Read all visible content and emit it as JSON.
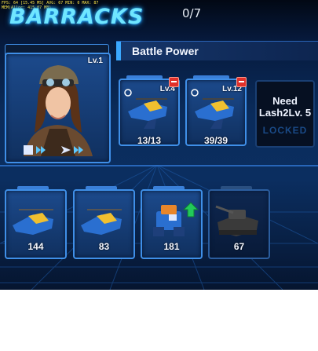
{
  "debug": {
    "line1": "FPS: 64 [15.45 MS] AVG: 67 MIN: 0 MAX: 87",
    "line2": "MEM(Alloc: 415.07 MB)"
  },
  "header": {
    "title": "BARRACKS",
    "unit_count": "0/7"
  },
  "battle_power": {
    "label": "Battle Power"
  },
  "commander": {
    "level": "Lv.1"
  },
  "slots": [
    {
      "level": "Lv.4",
      "count": "13/13"
    },
    {
      "level": "Lv.12",
      "count": "39/39"
    }
  ],
  "locked_slot": {
    "need_text": "Need Lash2Lv. 5",
    "locked_label": "LOCKED"
  },
  "units": [
    {
      "count": "144",
      "icon": "gunship-icon"
    },
    {
      "count": "83",
      "icon": "gunship-icon"
    },
    {
      "count": "181",
      "icon": "mech-icon",
      "upgrade": true
    },
    {
      "count": "67",
      "icon": "tank-icon"
    }
  ],
  "colors": {
    "accent": "#3aa8ff",
    "title_glow": "#6fe6ff",
    "alert": "#e0302a",
    "upgrade": "#22c95a"
  }
}
